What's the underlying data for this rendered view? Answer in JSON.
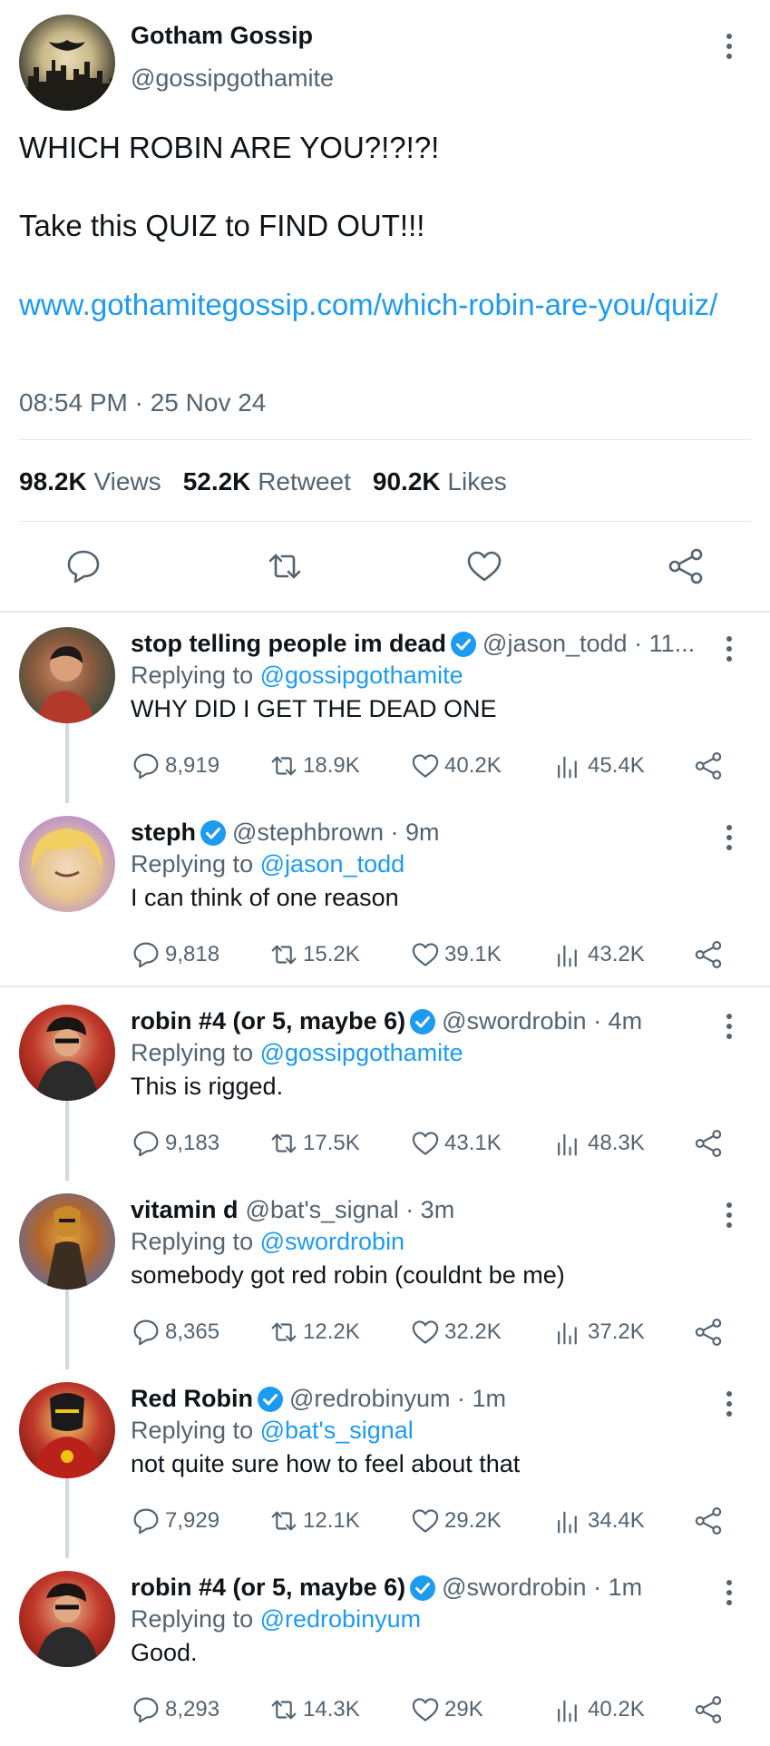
{
  "main_tweet": {
    "author_name": "Gotham Gossip",
    "author_handle": "@gossipgothamite",
    "text_line1": "WHICH ROBIN ARE YOU?!?!?!",
    "text_line2": "Take this QUIZ to FIND OUT!!!",
    "link": "www.gothamitegossip.com/which-robin-are-you/quiz/",
    "timestamp": "08:54 PM · 25 Nov 24",
    "stats": {
      "views_count": "98.2K",
      "views_label": "Views",
      "retweets_count": "52.2K",
      "retweets_label": "Retweet",
      "likes_count": "90.2K",
      "likes_label": "Likes"
    },
    "action_icons": [
      "reply-icon",
      "retweet-icon",
      "like-icon",
      "share-icon"
    ]
  },
  "replies": [
    {
      "name": "stop telling people im dead",
      "verified": true,
      "handle_time": "@jason_todd · 11...",
      "replying_label": "Replying to",
      "replying_to": "@gossipgothamite",
      "text": "WHY DID I GET THE DEAD ONE",
      "replies": "8,919",
      "retweets": "18.9K",
      "likes": "40.2K",
      "views": "45.4K"
    },
    {
      "name": "steph",
      "verified": true,
      "handle_time": "@stephbrown · 9m",
      "replying_label": "Replying to",
      "replying_to": "@jason_todd",
      "text": "I can think of one reason",
      "replies": "9,818",
      "retweets": "15.2K",
      "likes": "39.1K",
      "views": "43.2K"
    },
    {
      "name": "robin #4 (or 5, maybe 6)",
      "verified": true,
      "handle_time": "@swordrobin · 4m",
      "replying_label": "Replying to",
      "replying_to": "@gossipgothamite",
      "text": "This is rigged.",
      "replies": "9,183",
      "retweets": "17.5K",
      "likes": "43.1K",
      "views": "48.3K"
    },
    {
      "name": "vitamin d",
      "verified": false,
      "handle_time": "@bat's_signal · 3m",
      "replying_label": "Replying to",
      "replying_to": "@swordrobin",
      "text": "somebody got red robin (couldnt be me)",
      "replies": "8,365",
      "retweets": "12.2K",
      "likes": "32.2K",
      "views": "37.2K"
    },
    {
      "name": "Red Robin",
      "verified": true,
      "handle_time": "@redrobinyum · 1m",
      "replying_label": "Replying to",
      "replying_to": "@bat's_signal",
      "text": "not quite sure how to feel about that",
      "replies": "7,929",
      "retweets": "12.1K",
      "likes": "29.2K",
      "views": "34.4K"
    },
    {
      "name": "robin #4 (or 5, maybe 6)",
      "verified": true,
      "handle_time": "@swordrobin · 1m",
      "replying_label": "Replying to",
      "replying_to": "@redrobinyum",
      "text": "Good.",
      "replies": "8,293",
      "retweets": "14.3K",
      "likes": "29K",
      "views": "40.2K"
    }
  ],
  "colors": {
    "accent": "#1d9bf0",
    "muted": "#536471",
    "text": "#0f1419",
    "divider": "#e4e8eb"
  }
}
